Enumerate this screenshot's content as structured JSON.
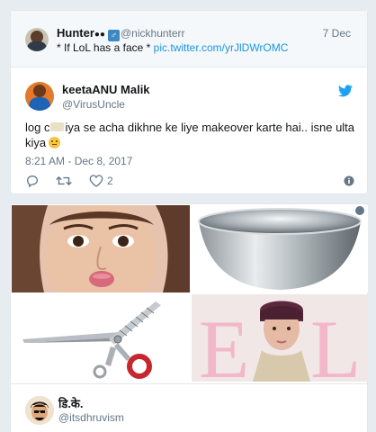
{
  "quoted": {
    "display_name": "Hunter",
    "display_emoji": "🔥",
    "handle": "@nickhunterr",
    "date": "7 Dec",
    "text": "* If LoL has a face *",
    "link": "pic.twitter.com/yrJlDWrOMC"
  },
  "tweet": {
    "display_name": "keetaANU Malik",
    "handle": "@VirusUncle",
    "text_part1": "log c",
    "text_part2": "iya se acha dikhne ke liye makeover karte hai.. isne ulta kiya",
    "timestamp": "8:21 AM - Dec 8, 2017",
    "like_count": "2",
    "icons": {
      "reply": "reply-icon",
      "retweet": "retweet-icon",
      "like": "heart-icon",
      "info": "info-icon",
      "bird": "twitter-bird-icon"
    },
    "accent_color": "#1da1f2"
  },
  "next_tweet": {
    "display_name": "डि.के.",
    "handle": "@itsdhruvism"
  },
  "media": {
    "items": [
      "face-pout-photo",
      "steel-bowl-photo",
      "scissors-photo",
      "magazine-cover-photo"
    ]
  }
}
